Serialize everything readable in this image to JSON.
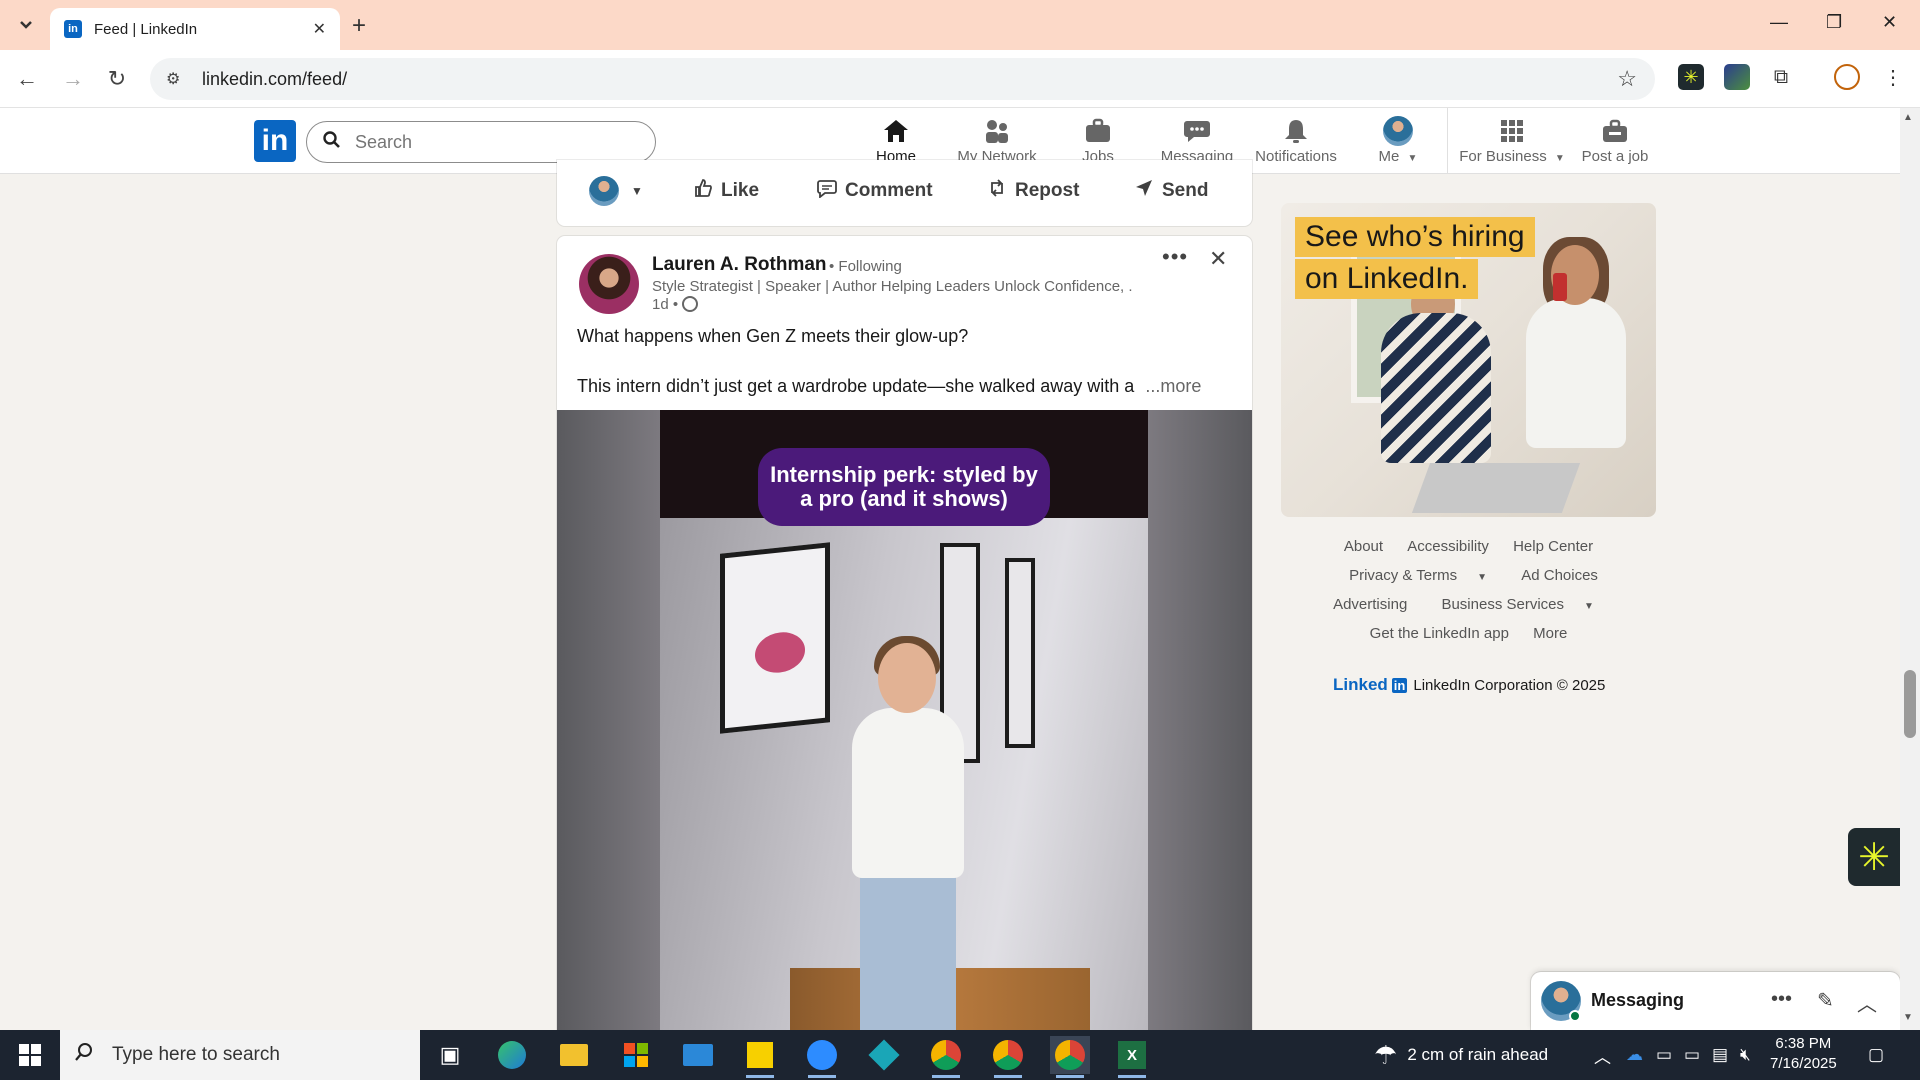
{
  "browser": {
    "tab_title": "Feed | LinkedIn",
    "url": "linkedin.com/feed/"
  },
  "linkedin_header": {
    "logo": "in",
    "search_placeholder": "Search",
    "nav": [
      {
        "label": "Home",
        "icon": "home-icon",
        "active": true
      },
      {
        "label": "My Network",
        "icon": "network-icon",
        "active": false
      },
      {
        "label": "Jobs",
        "icon": "briefcase-icon",
        "active": false
      },
      {
        "label": "Messaging",
        "icon": "messaging-icon",
        "active": false
      },
      {
        "label": "Notifications",
        "icon": "bell-icon",
        "active": false
      },
      {
        "label": "Me",
        "icon": "avatar",
        "active": false
      },
      {
        "label": "For Business",
        "icon": "grid-icon",
        "active": false
      },
      {
        "label": "Post a job",
        "icon": "post-job-icon",
        "active": false
      }
    ]
  },
  "previous_post_actions": {
    "like": "Like",
    "comment": "Comment",
    "repost": "Repost",
    "send": "Send"
  },
  "post": {
    "author": "Lauren A. Rothman",
    "following": "• Following",
    "headline": "Style Strategist | Speaker | Author Helping Leaders Unlock Confidence, ...",
    "time": "1d •",
    "text_line1": "What happens when Gen Z meets their glow-up?",
    "text_line2": "This intern didn’t just get a wardrobe update—she walked away with a",
    "more": "...more",
    "video_caption": "Internship perk: styled by a pro (and it shows)"
  },
  "right_rail": {
    "ad_line1": "See who’s hiring",
    "ad_line2": "on LinkedIn.",
    "footer": {
      "about": "About",
      "accessibility": "Accessibility",
      "help_center": "Help Center",
      "privacy_terms": "Privacy & Terms",
      "ad_choices": "Ad Choices",
      "advertising": "Advertising",
      "business_services": "Business Services",
      "get_app": "Get the LinkedIn app",
      "more": "More"
    },
    "corp_word": "Linked",
    "corp_box": "in",
    "corp_text": "LinkedIn Corporation © 2025"
  },
  "messaging_widget": {
    "title": "Messaging"
  },
  "taskbar": {
    "search_placeholder": "Type here to search",
    "weather": "2 cm of rain ahead",
    "time": "6:38 PM",
    "date": "7/16/2025"
  },
  "colors": {
    "linkedin_blue": "#0a66c2",
    "tabbar_bg": "#fcd9c8",
    "caption_purple": "#4b1a7a",
    "ad_yellow": "#f3c04a"
  }
}
